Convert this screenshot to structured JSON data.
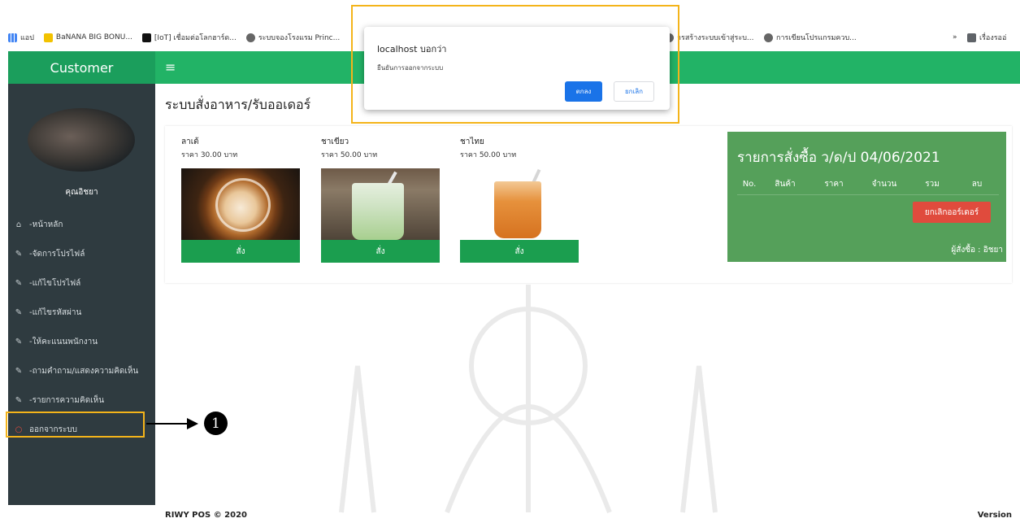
{
  "bookmarks": {
    "apps_label": "แอป",
    "items": [
      {
        "label": "BaNANA BIG BONU..."
      },
      {
        "label": "[IoT] เชื่อมต่อโลกฮาร์ด..."
      },
      {
        "label": "ระบบจองโรงแรม Princ..."
      },
      {
        "label": "ารสร้างระบบเข้าสู่ระบ..."
      },
      {
        "label": "การเขียนโปรแกรมควบ..."
      }
    ],
    "overflow": "»",
    "reading_list": "เรื่องรออ่"
  },
  "header": {
    "app_title": "Customer",
    "menu_icon": "≡"
  },
  "sidebar": {
    "user_name": "คุณอิชยา",
    "items": [
      {
        "label": "-หน้าหลัก",
        "icon": "home-icon",
        "glyph": "🏠"
      },
      {
        "label": "-จัดการโปรไฟล์",
        "icon": "edit-icon",
        "glyph": "✎"
      },
      {
        "label": "-แก้ไขโปรไฟล์",
        "icon": "edit-icon",
        "glyph": "✎"
      },
      {
        "label": "-แก้ไขรหัสผ่าน",
        "icon": "edit-icon",
        "glyph": "✎"
      },
      {
        "label": "-ให้คะแนนพนักงาน",
        "icon": "edit-icon",
        "glyph": "✎"
      },
      {
        "label": "-ถามคำถาม/แสดงความคิดเห็น",
        "icon": "edit-icon",
        "glyph": "✎"
      },
      {
        "label": "-รายการความคิดเห็น",
        "icon": "edit-icon",
        "glyph": "✎"
      },
      {
        "label": "ออกจากระบบ",
        "icon": "circle-icon",
        "glyph": "○"
      }
    ]
  },
  "main": {
    "page_title": "ระบบสั่งอาหาร/รับออเดอร์",
    "products": [
      {
        "name": "ลาเต้",
        "price": "ราคา 30.00 บาท",
        "button": "สั่ง"
      },
      {
        "name": "ชาเขียว",
        "price": "ราคา 50.00 บาท",
        "button": "สั่ง"
      },
      {
        "name": "ชาไทย",
        "price": "ราคา 50.00 บาท",
        "button": "สั่ง"
      }
    ],
    "order": {
      "title": "รายการสั่งซื้อ ว/ด/ป 04/06/2021",
      "columns": [
        "No.",
        "สินค้า",
        "ราคา",
        "จำนวน",
        "รวม",
        "ลบ"
      ],
      "cancel_button": "ยกเลิกออร์เดอร์",
      "orderer": "ผู้สั่งซื้อ : อิชยา"
    }
  },
  "dialog": {
    "title": "localhost บอกว่า",
    "message": "ยืนยันการออกจากระบบ",
    "ok_label": "ตกลง",
    "cancel_label": "ยกเลิก"
  },
  "annotation": {
    "callout_number": "1"
  },
  "footer": {
    "left": "RIWY POS © 2020",
    "right": "Version"
  },
  "colors": {
    "sidebar": "#2f3b40",
    "topbar": "#22b366",
    "order_panel": "#55a05a",
    "highlight": "#f4b41a",
    "button_green": "#1b9e4f",
    "cancel_red": "#e04b3d"
  }
}
